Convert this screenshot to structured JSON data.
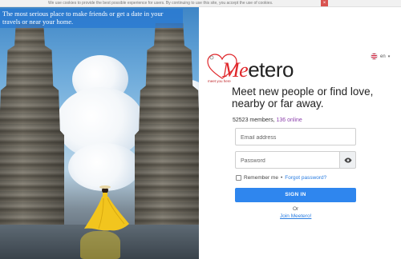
{
  "cookie_bar": {
    "text": "We use cookies to provide the best possible experience for users. By continuing to use this site, you accept the use of cookies.",
    "close_label": "×"
  },
  "hero": {
    "caption": "The most serious place to make friends or get a date in your travels or near your home."
  },
  "brand": {
    "logo_prefix": "M",
    "logo_accent": "e",
    "logo_suffix": "etero",
    "tagline": "meet you here"
  },
  "language": {
    "code": "en",
    "flag_icon": "us-flag-icon"
  },
  "headline": "Meet new people or find love, nearby or far away.",
  "stats": {
    "members": "52523 members,",
    "online": "136 online"
  },
  "form": {
    "email_placeholder": "Email address",
    "password_placeholder": "Password",
    "remember_label": "Remember me",
    "forgot_label": "Forgot password?",
    "signin_label": "SIGN IN",
    "or_label": "Or",
    "join_label": "Join Meetero!"
  },
  "colors": {
    "accent": "#2f86ee",
    "brand_red": "#e0272b",
    "online": "#8e44ad"
  }
}
